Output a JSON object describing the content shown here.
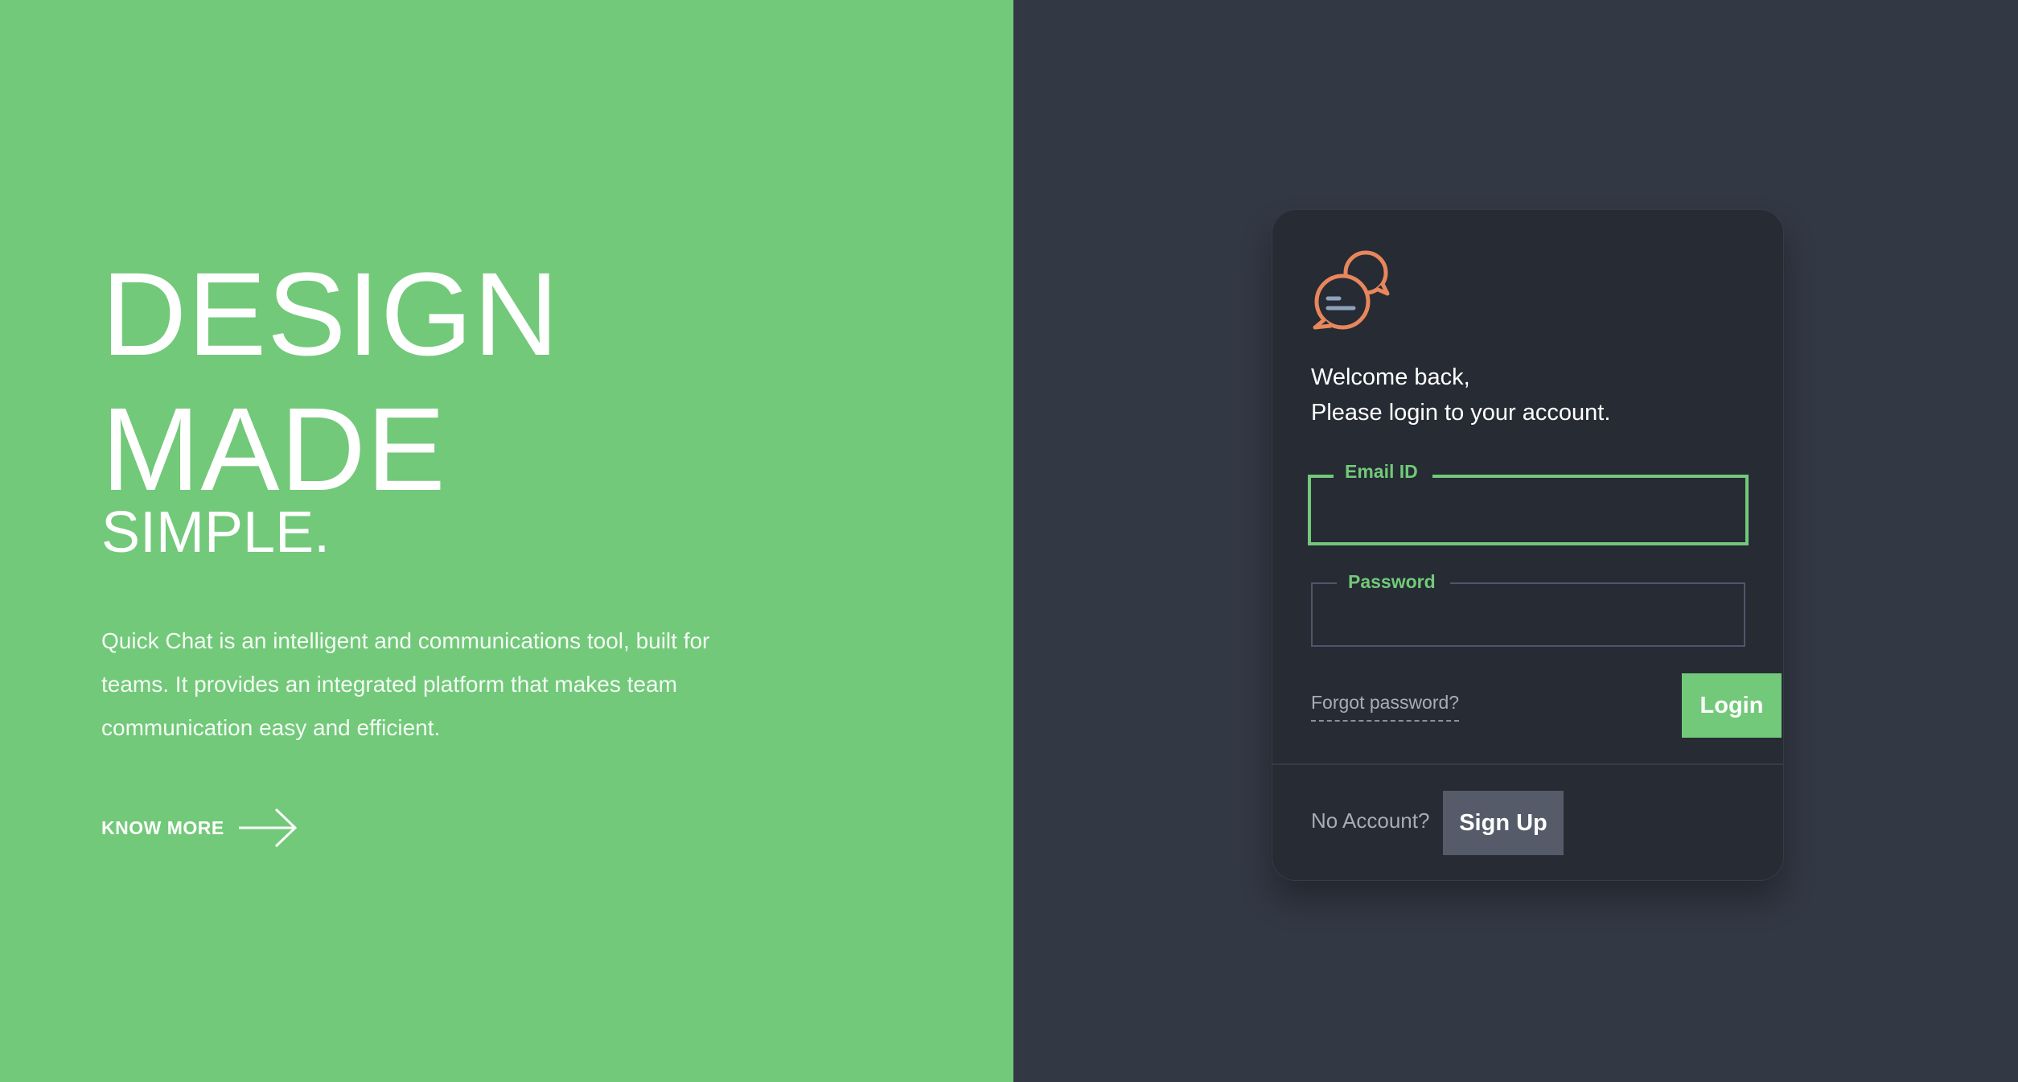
{
  "hero": {
    "title_line1": "DESIGN",
    "title_line2": "MADE",
    "title_line3": "SIMPLE.",
    "description": "Quick Chat is an intelligent and communications tool, built for teams. It provides an integrated platform that makes team communication easy and efficient.",
    "know_more_label": "KNOW MORE",
    "know_more_icon": "arrow-right-icon"
  },
  "login_card": {
    "logo_icon": "chat-bubbles-icon",
    "welcome_line1": "Welcome back,",
    "welcome_line2": "Please login to your account.",
    "email": {
      "label": "Email ID",
      "value": "",
      "placeholder": ""
    },
    "password": {
      "label": "Password",
      "value": "",
      "placeholder": ""
    },
    "forgot_password_label": "Forgot password?",
    "login_label": "Login",
    "no_account_label": "No Account?",
    "signup_label": "Sign Up"
  },
  "colors": {
    "brand_green": "#72c979",
    "panel_dark": "#323844",
    "card_dark": "#262b34",
    "logo_orange": "#e8865c",
    "secondary_button": "#555b68"
  }
}
